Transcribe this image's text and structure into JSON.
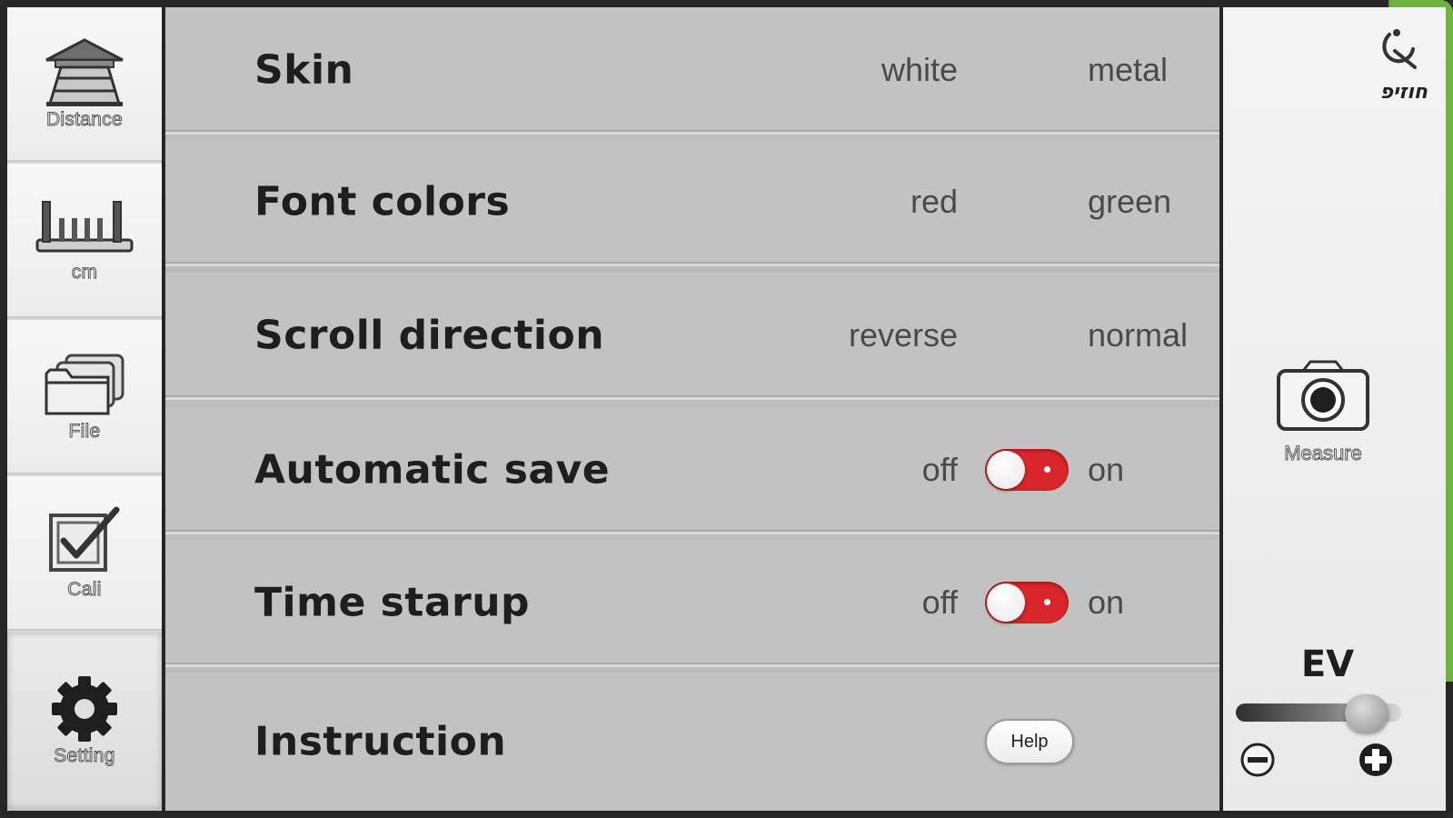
{
  "sidebar": {
    "items": [
      {
        "label": "Distance",
        "icon": "distance-icon"
      },
      {
        "label": "cm",
        "icon": "ruler-icon"
      },
      {
        "label": "File",
        "icon": "folder-icon"
      },
      {
        "label": "Cali",
        "icon": "calibrate-icon"
      },
      {
        "label": "Setting",
        "icon": "gear-icon",
        "active": true
      }
    ]
  },
  "settings": {
    "rows": [
      {
        "title": "Skin",
        "left": "white",
        "right": "metal",
        "state": "right",
        "color": "#d4d4d8",
        "dot": "#6b6b8a"
      },
      {
        "title": "Font colors",
        "left": "red",
        "right": "green",
        "state": "right",
        "color": "#6db33f",
        "dot": "#ffffff"
      },
      {
        "title": "Scroll direction",
        "left": "reverse",
        "right": "normal",
        "state": "right",
        "color": "#6db33f",
        "dot": "#ffffff"
      },
      {
        "title": "Automatic save",
        "left": "off",
        "right": "on",
        "state": "left",
        "color": "#d9262b",
        "dot": "#ffffff"
      },
      {
        "title": "Time starup",
        "left": "off",
        "right": "on",
        "state": "left",
        "color": "#d9262b",
        "dot": "#ffffff"
      },
      {
        "title": "Instruction",
        "button": "Help"
      }
    ]
  },
  "right_panel": {
    "brand_text": "חוזיפ",
    "measure_label": "Measure",
    "ev_label": "EV",
    "ev_level": 0.85
  }
}
